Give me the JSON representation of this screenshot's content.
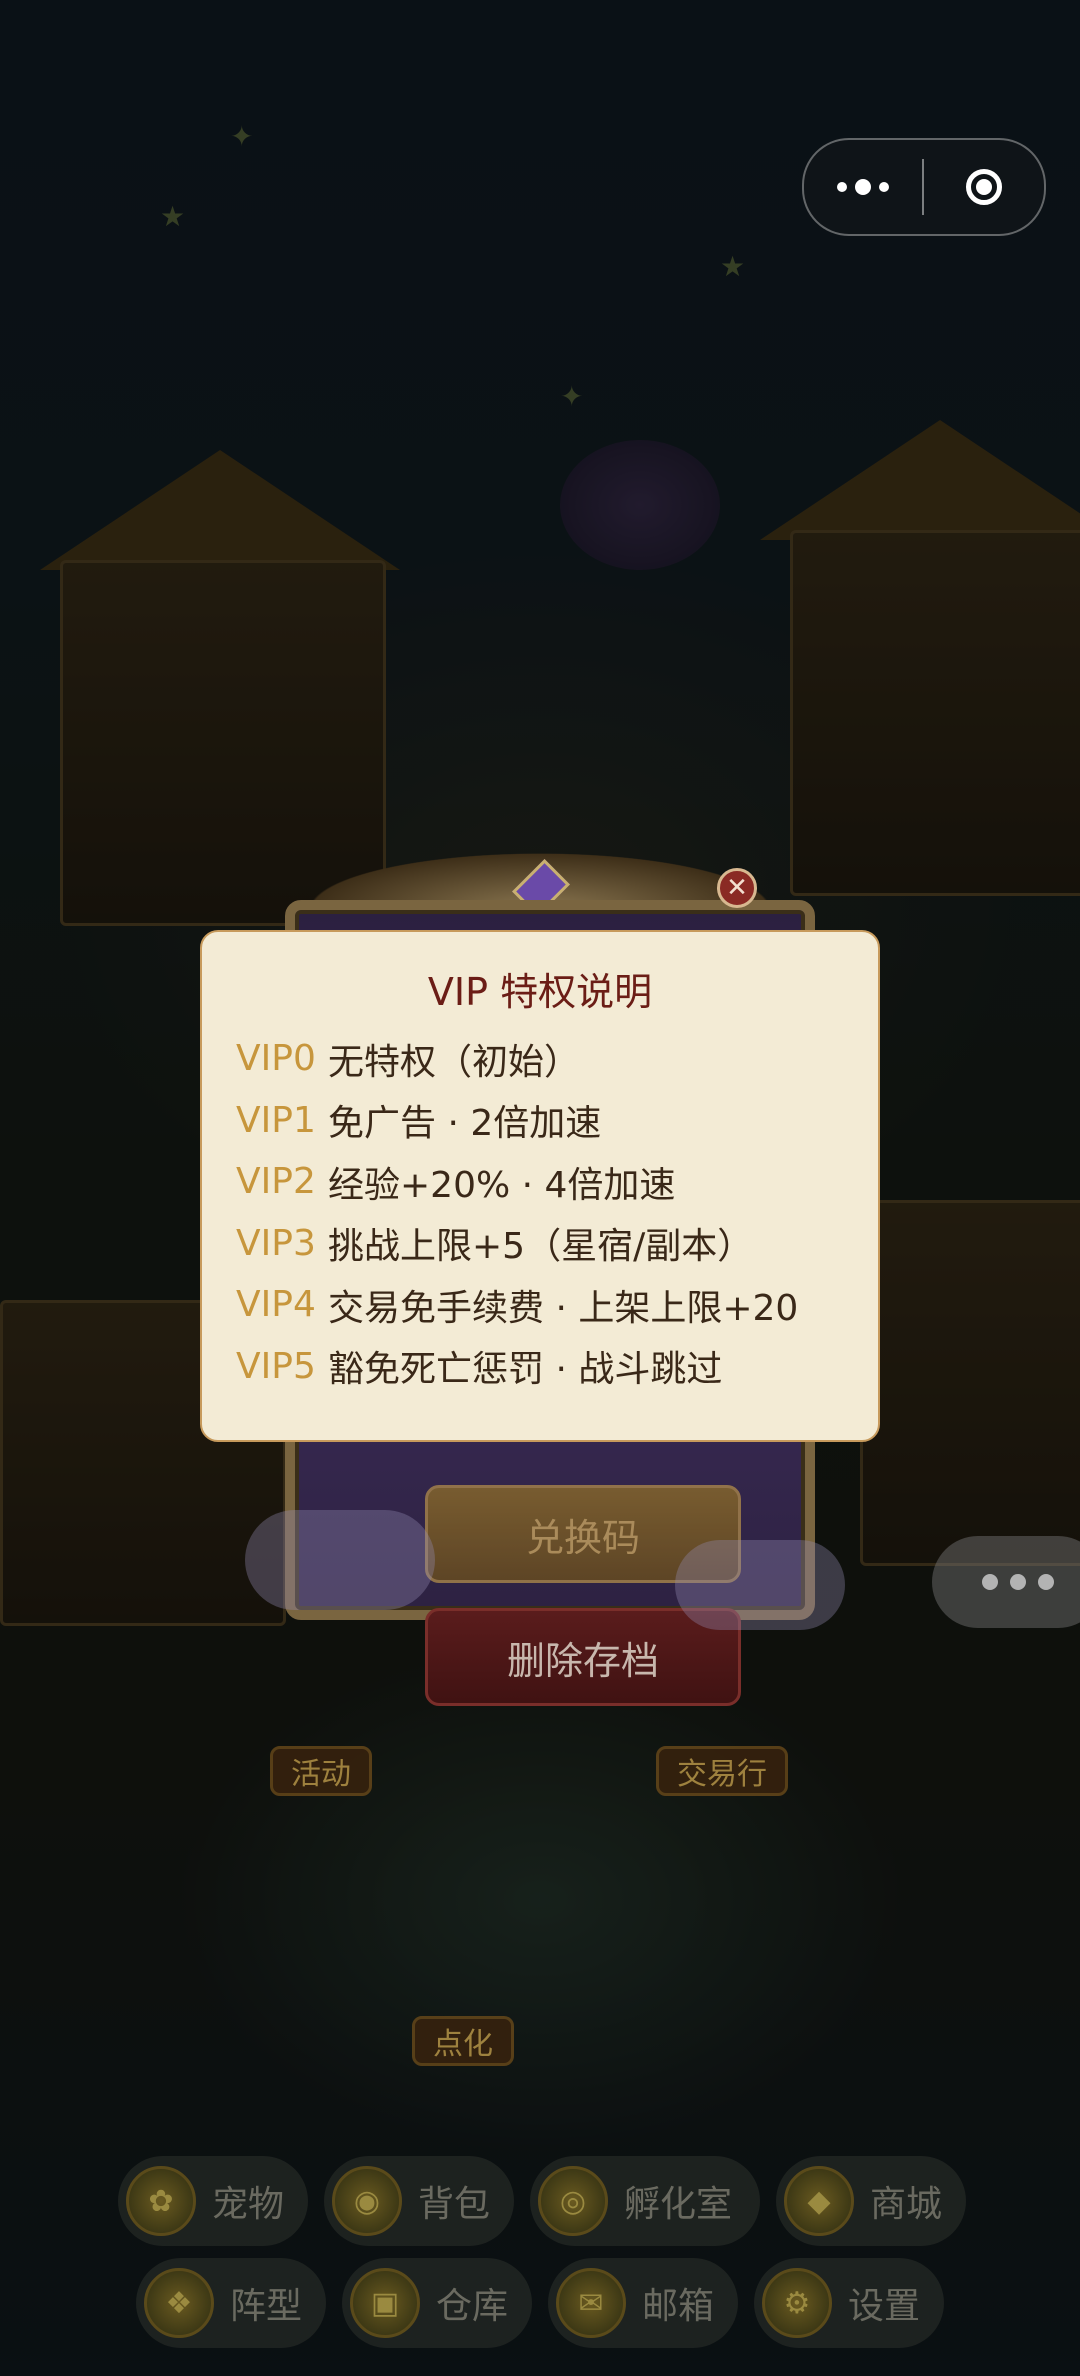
{
  "top_capsule": {
    "more_icon": "more-dots-icon",
    "close_icon": "target-circle-icon"
  },
  "background_dialog": {
    "close_icon": "close-x-icon",
    "redeem_button": "兑换码",
    "delete_button": "删除存档"
  },
  "vip_panel": {
    "title": "VIP 特权说明",
    "rows": [
      {
        "level": "VIP0",
        "desc": "无特权（初始）"
      },
      {
        "level": "VIP1",
        "desc": "免广告 · 2倍加速"
      },
      {
        "level": "VIP2",
        "desc": "经验+20% · 4倍加速"
      },
      {
        "level": "VIP3",
        "desc": "挑战上限+5（星宿/副本）"
      },
      {
        "level": "VIP4",
        "desc": "交易免手续费 · 上架上限+20"
      },
      {
        "level": "VIP5",
        "desc": "豁免死亡惩罚 · 战斗跳过"
      }
    ]
  },
  "map_signs": {
    "activity": "活动",
    "trade": "交易行",
    "enlighten": "点化"
  },
  "bottom_nav": {
    "row1": [
      {
        "label": "宠物",
        "icon": "pet-icon"
      },
      {
        "label": "背包",
        "icon": "backpack-icon"
      },
      {
        "label": "孵化室",
        "icon": "hatchery-icon"
      },
      {
        "label": "商城",
        "icon": "shop-icon"
      }
    ],
    "row2": [
      {
        "label": "阵型",
        "icon": "formation-icon"
      },
      {
        "label": "仓库",
        "icon": "warehouse-icon"
      },
      {
        "label": "邮箱",
        "icon": "mailbox-icon"
      },
      {
        "label": "设置",
        "icon": "settings-icon"
      }
    ]
  },
  "colors": {
    "panel_bg": "#f3ebd5",
    "panel_border": "#c79a5c",
    "title": "#6b1d16",
    "level": "#c7963c",
    "text": "#3a2818"
  }
}
